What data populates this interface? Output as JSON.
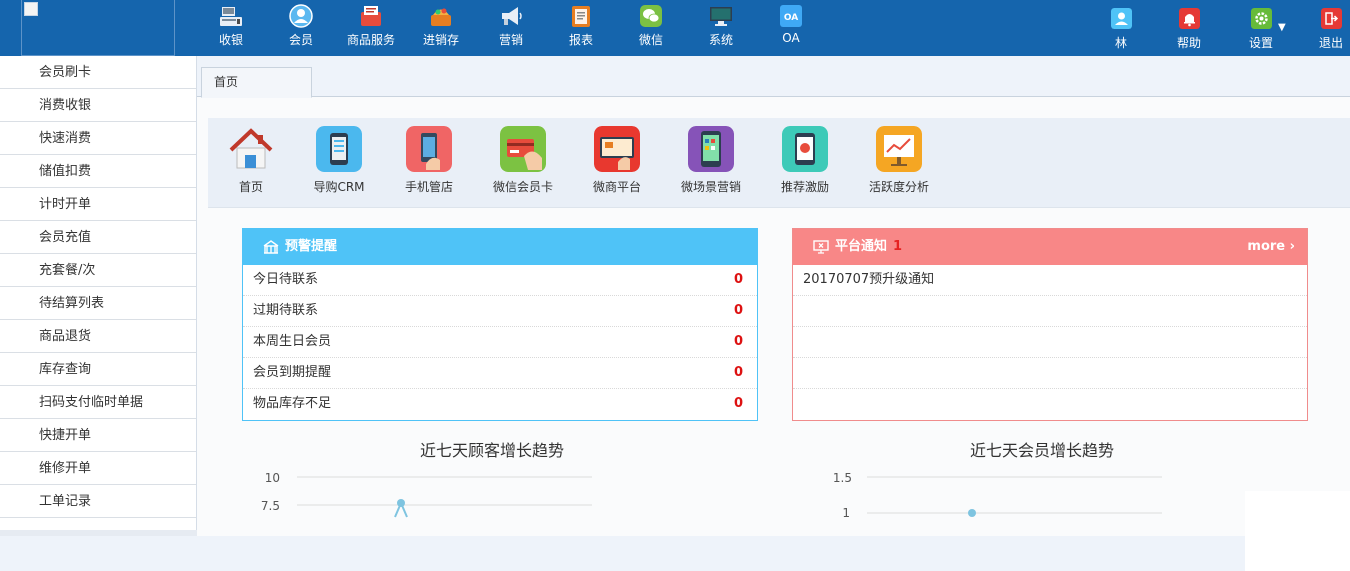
{
  "topnav": {
    "items": [
      {
        "label": "收银",
        "icon": "cash-register-icon",
        "color": "#e8eef6"
      },
      {
        "label": "会员",
        "icon": "member-icon",
        "color": "#5bb8f0"
      },
      {
        "label": "商品服务",
        "icon": "product-service-icon",
        "color": "#e74c3c"
      },
      {
        "label": "进销存",
        "icon": "inventory-icon",
        "color": "#f39c12"
      },
      {
        "label": "营销",
        "icon": "megaphone-icon",
        "color": "#e8eef6"
      },
      {
        "label": "报表",
        "icon": "report-icon",
        "color": "#e67e22"
      },
      {
        "label": "微信",
        "icon": "wechat-icon",
        "color": "#7bc043"
      },
      {
        "label": "系统",
        "icon": "monitor-icon",
        "color": "#34495e"
      },
      {
        "label": "OA",
        "icon": "oa-icon",
        "color": "#3fa9f5",
        "glyph": "OA"
      }
    ],
    "right": [
      {
        "label": "林",
        "icon": "user-icon",
        "color": "#4fc3f7"
      },
      {
        "label": "帮助",
        "icon": "bell-icon",
        "color": "#e53935"
      },
      {
        "label": "设置",
        "icon": "gear-icon",
        "color": "#66bb3a"
      },
      {
        "label": "退出",
        "icon": "logout-icon",
        "color": "#e53935"
      }
    ]
  },
  "sidebar": {
    "items": [
      "会员刷卡",
      "消费收银",
      "快速消费",
      "储值扣费",
      "计时开单",
      "会员充值",
      "充套餐/次",
      "待结算列表",
      "商品退货",
      "库存查询",
      "扫码支付临时单据",
      "快捷开单",
      "维修开单",
      "工单记录"
    ]
  },
  "tabs": {
    "home": "首页"
  },
  "quick": {
    "items": [
      {
        "label": "首页",
        "icon": "house-icon",
        "color": "#ffffff"
      },
      {
        "label": "导购CRM",
        "icon": "crm-tablet-icon",
        "color": "#4bb8ee"
      },
      {
        "label": "手机管店",
        "icon": "mobile-store-icon",
        "color": "#f06565"
      },
      {
        "label": "微信会员卡",
        "icon": "wechat-card-icon",
        "color": "#7cc242"
      },
      {
        "label": "微商平台",
        "icon": "micro-shop-icon",
        "color": "#e8382f"
      },
      {
        "label": "微场景营销",
        "icon": "micro-scene-icon",
        "color": "#8653b8"
      },
      {
        "label": "推荐激励",
        "icon": "referral-icon",
        "color": "#3dcab8"
      },
      {
        "label": "活跃度分析",
        "icon": "activity-chart-icon",
        "color": "#f5a623"
      }
    ]
  },
  "warning": {
    "title": "预警提醒",
    "rows": [
      {
        "label": "今日待联系",
        "value": "0"
      },
      {
        "label": "过期待联系",
        "value": "0"
      },
      {
        "label": "本周生日会员",
        "value": "0"
      },
      {
        "label": "会员到期提醒",
        "value": "0"
      },
      {
        "label": "物品库存不足",
        "value": "0"
      }
    ]
  },
  "notice": {
    "title": "平台通知",
    "count": "1",
    "more": "more ›",
    "rows": [
      "20170707预升级通知",
      "",
      "",
      "",
      ""
    ]
  },
  "chart_data": [
    {
      "type": "line",
      "title": "近七天顾客增长趋势",
      "yticks": [
        "10",
        "7.5"
      ],
      "series_color": "#7ec4e0"
    },
    {
      "type": "line",
      "title": "近七天会员增长趋势",
      "yticks": [
        "1.5",
        "1"
      ],
      "series_color": "#7ec4e0"
    }
  ]
}
